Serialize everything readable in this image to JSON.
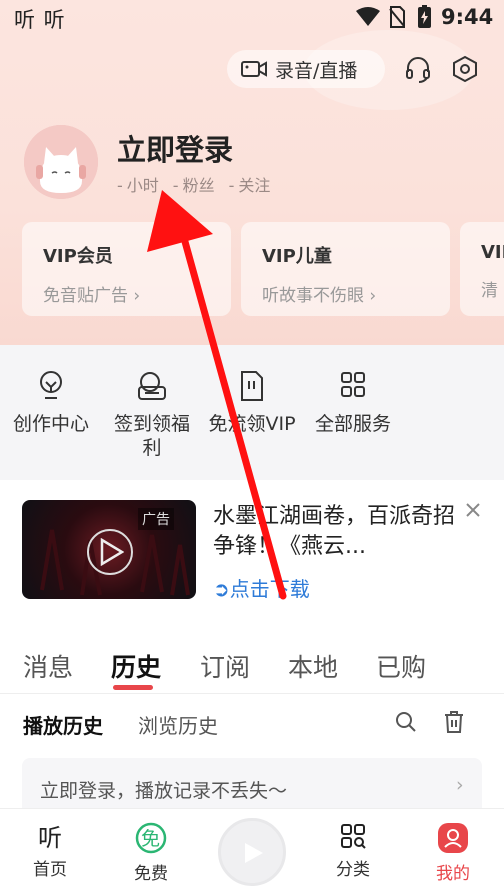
{
  "status_bar": {
    "app_label": "听 听",
    "time": "9:44"
  },
  "header": {
    "record_label": "录音/直播"
  },
  "profile": {
    "login_label": "立即登录",
    "hours_dash": "-",
    "hours_label": "小时",
    "fans_dash": "-",
    "fans_label": "粉丝",
    "follow_dash": "-",
    "follow_label": "关注"
  },
  "vip_cards": [
    {
      "title": "VIP会员",
      "subtitle": "免音贴广告"
    },
    {
      "title": "VIP儿童",
      "subtitle": "听故事不伤眼"
    },
    {
      "title": "VIP",
      "subtitle": "清"
    }
  ],
  "services": [
    {
      "label": "创作中心",
      "icon": "lightbulb-icon"
    },
    {
      "label": "签到领福利",
      "icon": "gift-icon"
    },
    {
      "label": "免流领VIP",
      "icon": "sim-card-icon"
    },
    {
      "label": "全部服务",
      "icon": "grid-icon"
    }
  ],
  "ad": {
    "badge": "广告",
    "title": "水墨江湖画卷，百派奇招争锋！《燕云...",
    "link": "点击下载"
  },
  "tabs": [
    "消息",
    "历史",
    "订阅",
    "本地",
    "已购"
  ],
  "active_tab": "历史",
  "subtabs": {
    "play_history": "播放历史",
    "browse_history": "浏览历史"
  },
  "prompt": {
    "text": "立即登录，播放记录不丢失～",
    "chevron": "›"
  },
  "bottom_nav": [
    {
      "label": "首页"
    },
    {
      "label": "免费"
    },
    {
      "label": "分类"
    },
    {
      "label": "我的"
    }
  ],
  "colors": {
    "accent": "#e8464a",
    "link": "#2e7bd8",
    "header_bg": "#fbe1da",
    "annotation_arrow": "#ff1111"
  }
}
